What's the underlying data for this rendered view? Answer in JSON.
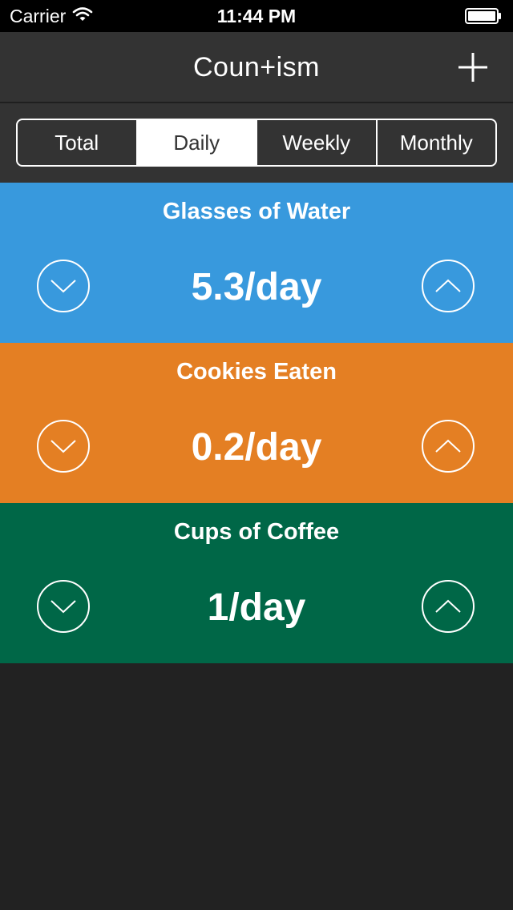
{
  "status_bar": {
    "carrier": "Carrier",
    "time": "11:44 PM"
  },
  "nav": {
    "title": "Coun+ism",
    "add_icon": "plus-icon"
  },
  "segments": {
    "items": [
      "Total",
      "Daily",
      "Weekly",
      "Monthly"
    ],
    "selected": "Daily"
  },
  "counters": [
    {
      "title": "Glasses of Water",
      "value": "5.3/day",
      "color": "#3899dd"
    },
    {
      "title": "Cookies Eaten",
      "value": "0.2/day",
      "color": "#e47f23"
    },
    {
      "title": "Cups of Coffee",
      "value": "1/day",
      "color": "#006747"
    }
  ],
  "colors": {
    "background": "#222222",
    "nav_background": "#333333",
    "status_background": "#000000"
  }
}
